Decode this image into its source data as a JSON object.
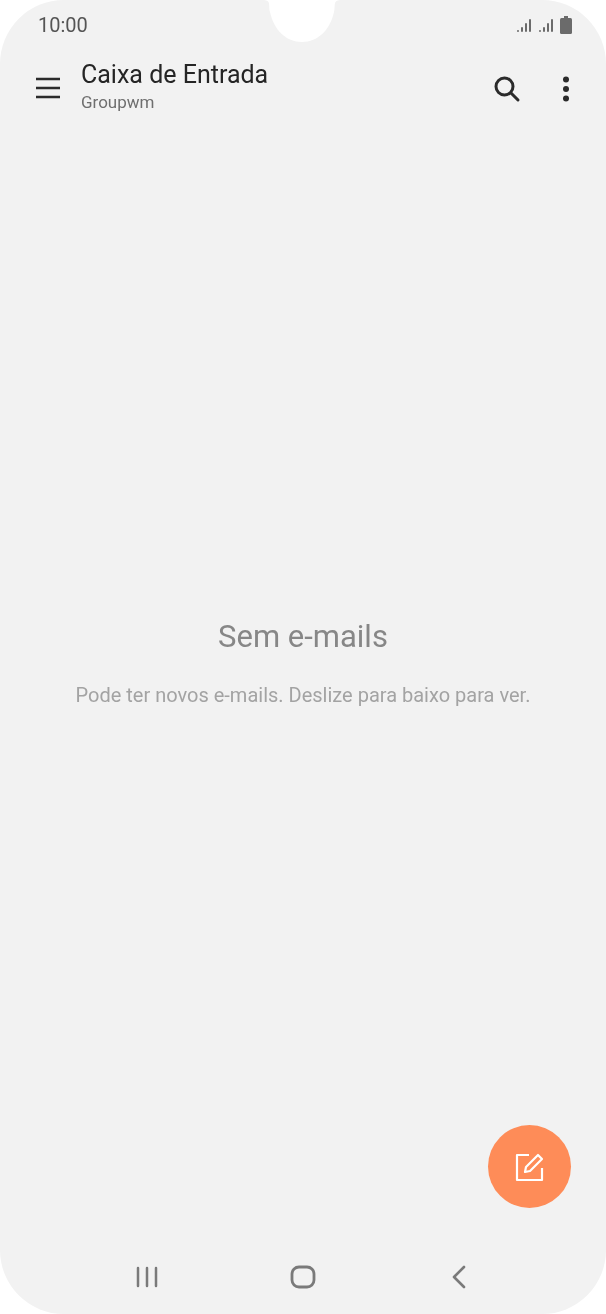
{
  "status_bar": {
    "time": "10:00"
  },
  "header": {
    "title": "Caixa de Entrada",
    "subtitle": "Groupwm"
  },
  "empty_state": {
    "title": "Sem e-mails",
    "message": "Pode ter novos e-mails. Deslize para baixo para ver."
  }
}
